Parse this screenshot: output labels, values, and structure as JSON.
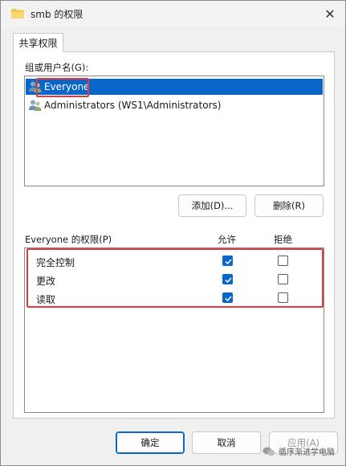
{
  "window": {
    "title": "smb 的权限",
    "close_glyph": "✕"
  },
  "tabs": [
    {
      "label": "共享权限"
    }
  ],
  "users_group": {
    "label": "组或用户名(G):",
    "users": [
      {
        "name": "Everyone",
        "selected": true
      },
      {
        "name": "Administrators (WS1\\Administrators)",
        "selected": false
      }
    ]
  },
  "user_actions": {
    "add_label": "添加(D)...",
    "remove_label": "删除(R)"
  },
  "permissions": {
    "label": "Everyone 的权限(P)",
    "allow_header": "允许",
    "deny_header": "拒绝",
    "rows": [
      {
        "name": "完全控制",
        "allow": true,
        "deny": false
      },
      {
        "name": "更改",
        "allow": true,
        "deny": false
      },
      {
        "name": "读取",
        "allow": true,
        "deny": false
      }
    ]
  },
  "footer": {
    "ok_label": "确定",
    "cancel_label": "取消",
    "apply_label": "应用(A)"
  },
  "watermark": {
    "text": "循序渐进学电脑"
  },
  "colors": {
    "accent": "#0a67c9",
    "highlight": "#e5393c"
  }
}
